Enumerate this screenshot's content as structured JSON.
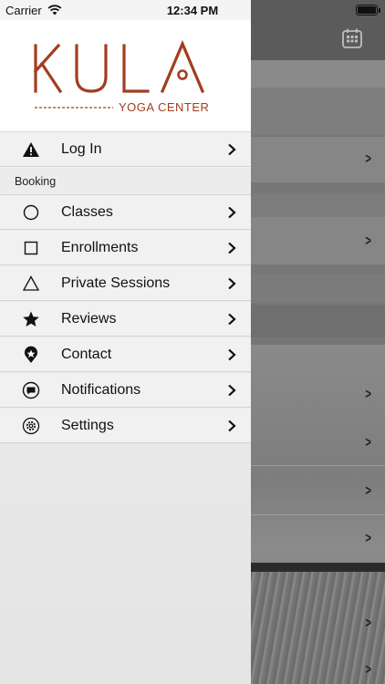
{
  "status_bar": {
    "carrier": "Carrier",
    "time": "12:34 PM"
  },
  "brand": {
    "name": "KULA",
    "tagline": "YOGA CENTER",
    "color": "#a23d1f"
  },
  "drawer": {
    "top_item": {
      "label": "Log In",
      "icon": "warning-icon"
    },
    "section_header": "Booking",
    "items": [
      {
        "label": "Classes",
        "icon": "circle-icon"
      },
      {
        "label": "Enrollments",
        "icon": "square-icon"
      },
      {
        "label": "Private Sessions",
        "icon": "triangle-icon"
      },
      {
        "label": "Reviews",
        "icon": "star-icon"
      },
      {
        "label": "Contact",
        "icon": "location-pin-icon"
      },
      {
        "label": "Notifications",
        "icon": "chat-bubble-icon"
      },
      {
        "label": "Settings",
        "icon": "gear-icon"
      }
    ]
  },
  "header": {
    "right_icon": "calendar-icon"
  }
}
